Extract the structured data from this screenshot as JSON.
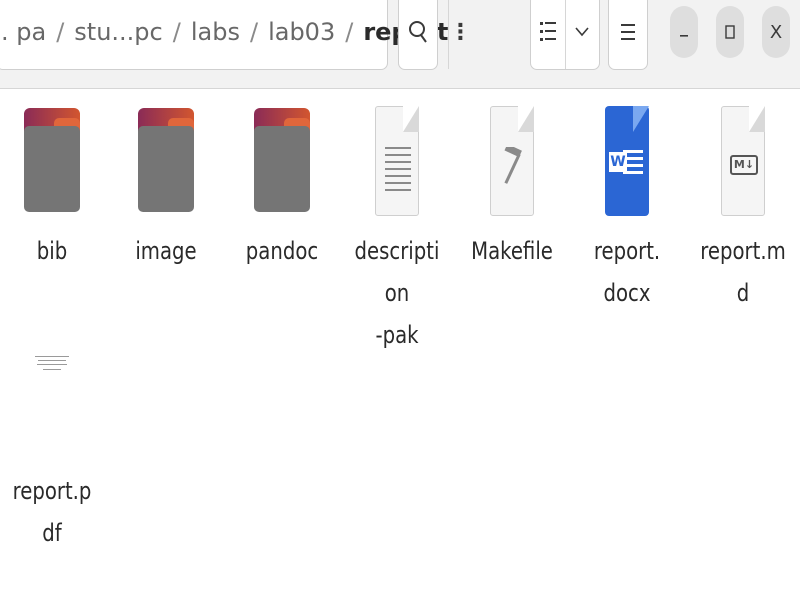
{
  "breadcrumbs": [
    ". pa",
    "stu...pc",
    "labs",
    "lab03",
    "report"
  ],
  "separator": "/",
  "toolbar": {
    "path_menu_icon": "vertical-dots-icon",
    "search_icon": "search-icon",
    "view_list_icon": "list-view-icon",
    "view_dropdown_icon": "chevron-down-icon",
    "main_menu_icon": "hamburger-menu-icon"
  },
  "window_controls": {
    "minimize_icon": "minimize-icon",
    "maximize_icon": "maximize-icon",
    "close_label": "X"
  },
  "files": [
    {
      "name": "bib",
      "type": "folder"
    },
    {
      "name": "image",
      "type": "folder"
    },
    {
      "name": "pandoc",
      "type": "folder"
    },
    {
      "name": "description\n-pak",
      "type": "text"
    },
    {
      "name": "Makefile",
      "type": "makefile"
    },
    {
      "name": "report.\ndocx",
      "type": "word"
    },
    {
      "name": "report.md",
      "type": "markdown"
    },
    {
      "name": "report.pdf",
      "type": "pdf"
    }
  ],
  "markdown_badge": "M↓",
  "word_badge": "W",
  "colors": {
    "folder_tab": "#d2562f",
    "folder_body": "#757575",
    "word_blue": "#2b66d4"
  }
}
